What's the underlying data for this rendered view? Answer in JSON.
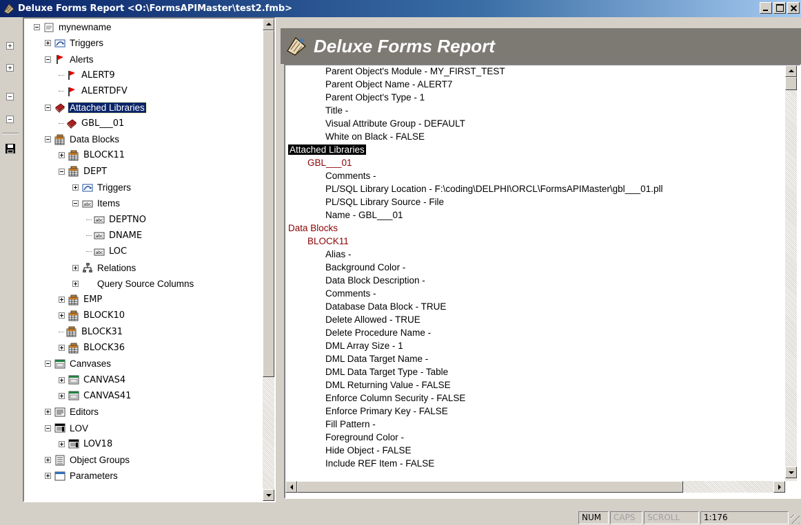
{
  "window": {
    "title": "Deluxe Forms Report <O:\\FormsAPIMaster\\test2.fmb>",
    "controls": [
      "minimize",
      "maximize",
      "close"
    ]
  },
  "toolbar": {
    "items": [
      {
        "name": "expand-all",
        "icon": "tree-expand-icon"
      },
      {
        "name": "expand-node",
        "icon": "tree-expand-node-icon"
      },
      {
        "name": "collapse-node",
        "icon": "tree-collapse-node-icon"
      },
      {
        "name": "collapse-all",
        "icon": "tree-collapse-all-icon"
      },
      {
        "name": "save",
        "icon": "floppy-disk-icon"
      }
    ]
  },
  "tree": {
    "items": [
      {
        "label": "mynewname",
        "depth": 0,
        "expander": "minus",
        "icon": "module-icon"
      },
      {
        "label": "Triggers",
        "depth": 1,
        "expander": "plus",
        "icon": "trigger-icon"
      },
      {
        "label": "Alerts",
        "depth": 1,
        "expander": "minus",
        "icon": "red-flag-icon"
      },
      {
        "label": "ALERT9",
        "depth": 2,
        "expander": "none",
        "icon": "red-flag-icon",
        "code": true
      },
      {
        "label": "ALERTDFV",
        "depth": 2,
        "expander": "none",
        "icon": "red-flag-icon",
        "code": true
      },
      {
        "label": "Attached Libraries",
        "depth": 1,
        "expander": "minus",
        "icon": "library-book-icon",
        "selected": true
      },
      {
        "label": "GBL___01",
        "depth": 2,
        "expander": "none",
        "icon": "library-book-icon",
        "code": true
      },
      {
        "label": "Data Blocks",
        "depth": 1,
        "expander": "minus",
        "icon": "data-block-icon"
      },
      {
        "label": "BLOCK11",
        "depth": 2,
        "expander": "plus",
        "icon": "data-block-icon",
        "code": true
      },
      {
        "label": "DEPT",
        "depth": 2,
        "expander": "minus",
        "icon": "data-block-icon",
        "code": true
      },
      {
        "label": "Triggers",
        "depth": 3,
        "expander": "plus",
        "icon": "trigger-icon"
      },
      {
        "label": "Items",
        "depth": 3,
        "expander": "minus",
        "icon": "text-item-icon"
      },
      {
        "label": "DEPTNO",
        "depth": 4,
        "expander": "none",
        "icon": "text-item-icon",
        "code": true
      },
      {
        "label": "DNAME",
        "depth": 4,
        "expander": "none",
        "icon": "text-item-icon",
        "code": true
      },
      {
        "label": "LOC",
        "depth": 4,
        "expander": "none",
        "icon": "text-item-icon",
        "code": true
      },
      {
        "label": "Relations",
        "depth": 3,
        "expander": "plus",
        "icon": "relation-icon"
      },
      {
        "label": "Query Source Columns",
        "depth": 3,
        "expander": "plus",
        "icon": "none"
      },
      {
        "label": "EMP",
        "depth": 2,
        "expander": "plus",
        "icon": "data-block-icon",
        "code": true
      },
      {
        "label": "BLOCK10",
        "depth": 2,
        "expander": "plus",
        "icon": "data-block-icon",
        "code": true
      },
      {
        "label": "BLOCK31",
        "depth": 2,
        "expander": "none",
        "icon": "data-block-icon",
        "code": true
      },
      {
        "label": "BLOCK36",
        "depth": 2,
        "expander": "plus",
        "icon": "data-block-icon",
        "code": true
      },
      {
        "label": "Canvases",
        "depth": 1,
        "expander": "minus",
        "icon": "canvas-icon"
      },
      {
        "label": "CANVAS4",
        "depth": 2,
        "expander": "plus",
        "icon": "canvas-icon",
        "code": true
      },
      {
        "label": "CANVAS41",
        "depth": 2,
        "expander": "plus",
        "icon": "canvas-icon",
        "code": true
      },
      {
        "label": "Editors",
        "depth": 1,
        "expander": "plus",
        "icon": "editor-icon"
      },
      {
        "label": "LOV",
        "depth": 1,
        "expander": "minus",
        "icon": "lov-icon"
      },
      {
        "label": "LOV18",
        "depth": 2,
        "expander": "plus",
        "icon": "lov-icon",
        "code": true
      },
      {
        "label": "Object Groups",
        "depth": 1,
        "expander": "plus",
        "icon": "object-group-icon"
      },
      {
        "label": "Parameters",
        "depth": 1,
        "expander": "plus",
        "icon": "parameter-icon"
      }
    ],
    "scroll_position": 0.0
  },
  "report": {
    "header_title": "Deluxe Forms Report",
    "lines": [
      {
        "text": "Parent Object's Module - MY_FIRST_TEST",
        "kind": "prop"
      },
      {
        "text": "Parent Object Name - ALERT7",
        "kind": "prop"
      },
      {
        "text": "Parent Object's Type - 1",
        "kind": "prop"
      },
      {
        "text": "Title -",
        "kind": "prop"
      },
      {
        "text": "Visual Attribute Group - DEFAULT",
        "kind": "prop"
      },
      {
        "text": "White on Black - FALSE",
        "kind": "prop"
      },
      {
        "text": "Attached Libraries",
        "kind": "highlight"
      },
      {
        "text": "GBL___01",
        "kind": "object"
      },
      {
        "text": "Comments -",
        "kind": "prop"
      },
      {
        "text": "PL/SQL Library Location - F:\\coding\\DELPHI\\ORCL\\FormsAPIMaster\\gbl___01.pll",
        "kind": "prop"
      },
      {
        "text": "PL/SQL Library Source - File",
        "kind": "prop"
      },
      {
        "text": "Name - GBL___01",
        "kind": "prop"
      },
      {
        "text": "Data Blocks",
        "kind": "section"
      },
      {
        "text": "BLOCK11",
        "kind": "object"
      },
      {
        "text": "Alias -",
        "kind": "prop"
      },
      {
        "text": "Background Color -",
        "kind": "prop"
      },
      {
        "text": "Data Block Description -",
        "kind": "prop"
      },
      {
        "text": "Comments -",
        "kind": "prop"
      },
      {
        "text": "Database Data Block - TRUE",
        "kind": "prop"
      },
      {
        "text": "Delete Allowed - TRUE",
        "kind": "prop"
      },
      {
        "text": "Delete Procedure Name -",
        "kind": "prop"
      },
      {
        "text": "DML Array Size - 1",
        "kind": "prop"
      },
      {
        "text": "DML Data Target Name -",
        "kind": "prop"
      },
      {
        "text": "DML Data Target Type - Table",
        "kind": "prop"
      },
      {
        "text": "DML Returning Value - FALSE",
        "kind": "prop"
      },
      {
        "text": "Enforce Column Security - FALSE",
        "kind": "prop"
      },
      {
        "text": "Enforce Primary Key - FALSE",
        "kind": "prop"
      },
      {
        "text": "Fill Pattern -",
        "kind": "prop"
      },
      {
        "text": "Foreground Color -",
        "kind": "prop"
      },
      {
        "text": "Hide Object - FALSE",
        "kind": "prop"
      },
      {
        "text": "Include REF Item - FALSE",
        "kind": "prop"
      }
    ]
  },
  "statusbar": {
    "num": "NUM",
    "caps": "CAPS",
    "scroll": "SCROLL",
    "position": "1:176"
  },
  "colors": {
    "titlebar_start": "#0a246a",
    "titlebar_end": "#a6caf0",
    "section_text": "#8b0000",
    "selection": "#0a246a",
    "header_band": "#7d7a74"
  }
}
